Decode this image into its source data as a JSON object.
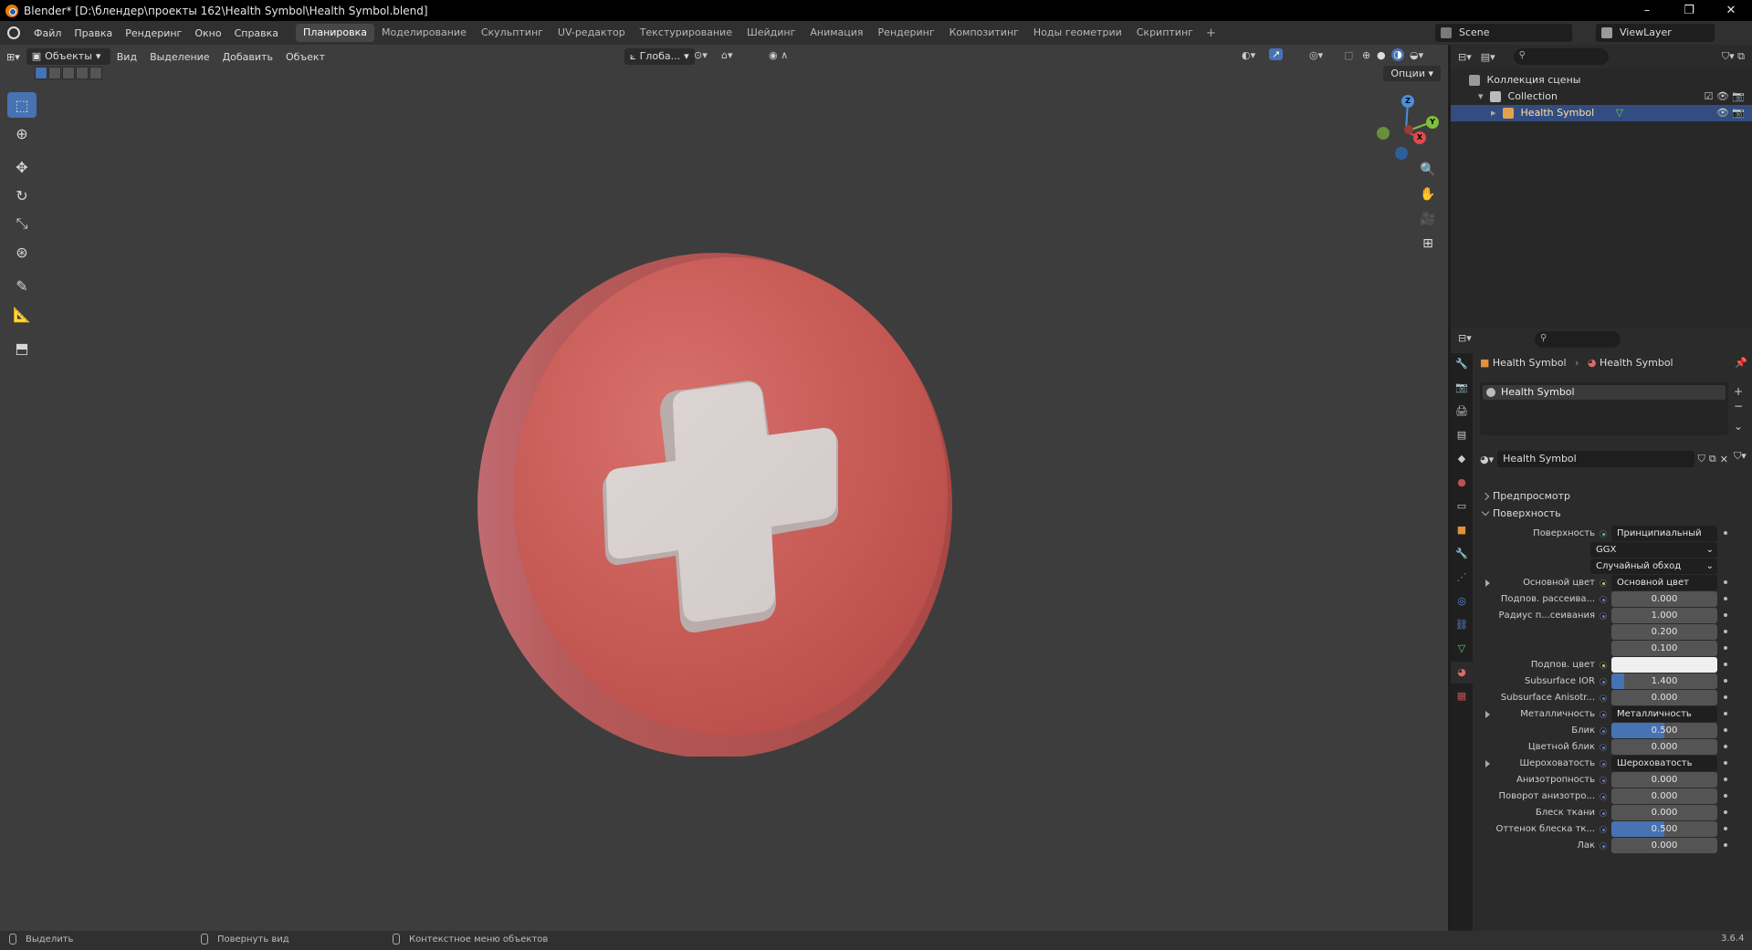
{
  "window": {
    "title": "Blender* [D:\\блендер\\проекты 162\\Health Symbol\\Health Symbol.blend]",
    "minimize": "–",
    "restore": "❐",
    "close": "✕"
  },
  "menu": {
    "items": [
      "Файл",
      "Правка",
      "Рендеринг",
      "Окно",
      "Справка"
    ]
  },
  "workspaces": {
    "tabs": [
      "Планировка",
      "Моделирование",
      "Скульптинг",
      "UV-редактор",
      "Текстурирование",
      "Шейдинг",
      "Анимация",
      "Рендеринг",
      "Композитинг",
      "Ноды геометрии",
      "Скриптинг"
    ],
    "active": "Планировка",
    "add": "+"
  },
  "scene": {
    "name": "Scene",
    "view_layer": "ViewLayer"
  },
  "viewport": {
    "mode": "Объекты",
    "menu": [
      "Вид",
      "Выделение",
      "Добавить",
      "Объект"
    ],
    "orientation": "Глоба...",
    "options": "Опции",
    "gizmo": {
      "x": "X",
      "y": "Y",
      "z": "Z"
    }
  },
  "outliner": {
    "root": "Коллекция сцены",
    "collection": "Collection",
    "object": "Health Symbol"
  },
  "properties": {
    "breadcrumb_object": "Health Symbol",
    "breadcrumb_material": "Health Symbol",
    "slot_name": "Health Symbol",
    "material_name": "Health Symbol",
    "panel_preview": "Предпросмотр",
    "panel_surface": "Поверхность",
    "rows": [
      {
        "label": "Поверхность",
        "value": "Принципиальный BSDF",
        "kind": "link",
        "dot": "green"
      },
      {
        "label": "",
        "value": "GGX",
        "kind": "dd"
      },
      {
        "label": "",
        "value": "Случайный обход",
        "kind": "dd"
      },
      {
        "label": "Основной цвет",
        "value": "Основной цвет",
        "kind": "link",
        "dot": "yellow",
        "tri": true
      },
      {
        "label": "Подпов. рассеива...",
        "value": "0.000",
        "kind": "num",
        "dot": "blue"
      },
      {
        "label": "Радиус п...сеивания",
        "value": "1.000",
        "kind": "num",
        "dot": "blue"
      },
      {
        "label": "",
        "value": "0.200",
        "kind": "num"
      },
      {
        "label": "",
        "value": "0.100",
        "kind": "num"
      },
      {
        "label": "Подпов. цвет",
        "value": "",
        "kind": "white",
        "dot": "yellow"
      },
      {
        "label": "Subsurface IOR",
        "value": "1.400",
        "kind": "num",
        "dot": "blue",
        "fill": 0.12
      },
      {
        "label": "Subsurface Anisotr...",
        "value": "0.000",
        "kind": "num",
        "dot": "blue"
      },
      {
        "label": "Металличность",
        "value": "Металличность",
        "kind": "link",
        "dot": "blue",
        "tri": true
      },
      {
        "label": "Блик",
        "value": "0.500",
        "kind": "num",
        "dot": "blue",
        "fill": 0.5
      },
      {
        "label": "Цветной блик",
        "value": "0.000",
        "kind": "num",
        "dot": "blue"
      },
      {
        "label": "Шероховатость",
        "value": "Шероховатость",
        "kind": "link",
        "dot": "blue",
        "tri": true
      },
      {
        "label": "Анизотропность",
        "value": "0.000",
        "kind": "num",
        "dot": "blue"
      },
      {
        "label": "Поворот анизотро...",
        "value": "0.000",
        "kind": "num",
        "dot": "blue"
      },
      {
        "label": "Блеск ткани",
        "value": "0.000",
        "kind": "num",
        "dot": "blue"
      },
      {
        "label": "Оттенок блеска тк...",
        "value": "0.500",
        "kind": "num",
        "dot": "blue",
        "fill": 0.5
      },
      {
        "label": "Лак",
        "value": "0.000",
        "kind": "num",
        "dot": "blue"
      }
    ]
  },
  "status": {
    "select": "Выделить",
    "rotate": "Повернуть вид",
    "context": "Контекстное меню объектов",
    "version": "3.6.4"
  },
  "colors": {
    "accent": "#4772b3",
    "selected_row": "#334d80",
    "object_red": "#c85a55",
    "cross_white": "#d9d2d0"
  }
}
